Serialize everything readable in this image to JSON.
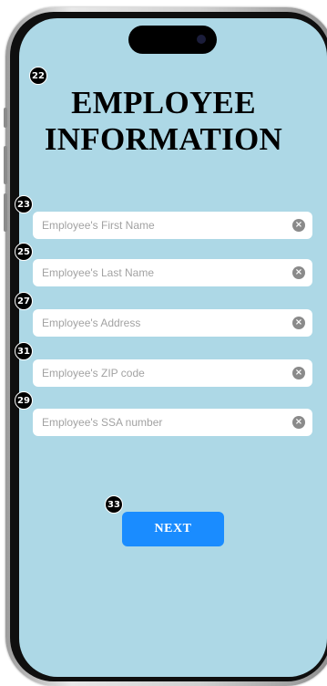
{
  "screen": {
    "title_line1": "EMPLOYEE",
    "title_line2": "INFORMATION",
    "background_color": "#add8e6"
  },
  "badges": {
    "title": "22",
    "first_name": "23",
    "last_name": "25",
    "address": "27",
    "zip": "31",
    "ssa": "29",
    "next": "33"
  },
  "form": {
    "first_name": {
      "placeholder": "Employee's First Name",
      "value": ""
    },
    "last_name": {
      "placeholder": "Employee's Last Name",
      "value": ""
    },
    "address": {
      "placeholder": "Employee's Address",
      "value": ""
    },
    "zip": {
      "placeholder": "Employee's ZIP code",
      "value": ""
    },
    "ssa": {
      "placeholder": "Employee's SSA number",
      "value": ""
    },
    "clear_icon": "close-circle-icon"
  },
  "actions": {
    "next_label": "NEXT",
    "accent_color": "#1a8cff"
  }
}
